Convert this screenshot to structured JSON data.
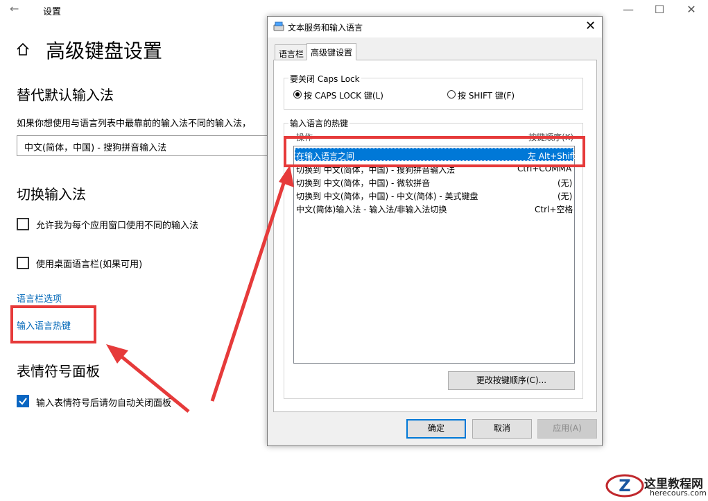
{
  "settings": {
    "title": "设置",
    "back_icon": "back-arrow-icon",
    "window_controls": [
      "—",
      "☐",
      "✕"
    ],
    "page_title": "高级键盘设置",
    "override_heading": "替代默认输入法",
    "override_desc": "如果你想使用与语言列表中最靠前的输入法不同的输入法，",
    "override_combo_value": "中文(简体，中国) - 搜狗拼音输入法",
    "switch_heading": "切换输入法",
    "checkbox_per_app": "允许我为每个应用窗口使用不同的输入法",
    "checkbox_desktop_bar": "使用桌面语言栏(如果可用)",
    "link_language_bar": "语言栏选项",
    "link_hotkeys": "输入语言热键",
    "emoji_heading": "表情符号面板",
    "checkbox_emoji": "输入表情符号后请勿自动关闭面板"
  },
  "dialog": {
    "title": "文本服务和输入语言",
    "close": "✕",
    "tabs": [
      "语言栏",
      "高级键设置"
    ],
    "capslock_group": "要关闭 Caps Lock",
    "radio_capslock": "按 CAPS LOCK 键(L)",
    "radio_shift": "按 SHIFT 键(F)",
    "hotkeys_group": "输入语言的热键",
    "col_action": "操作",
    "col_keys": "按键顺序(K)",
    "rows": [
      {
        "action": "在输入语言之间",
        "keys": "左 Alt+Shift"
      },
      {
        "action": "切换到 中文(简体，中国) - 搜狗拼音输入法",
        "keys": "Ctrl+COMMA"
      },
      {
        "action": "切换到 中文(简体，中国) - 微软拼音",
        "keys": "(无)"
      },
      {
        "action": "切换到 中文(简体，中国) - 中文(简体) - 美式键盘",
        "keys": "(无)"
      },
      {
        "action": "中文(简体)输入法 - 输入法/非输入法切换",
        "keys": "Ctrl+空格"
      }
    ],
    "change_button": "更改按键顺序(C)...",
    "ok": "确定",
    "cancel": "取消",
    "apply": "应用(A)"
  },
  "watermark": {
    "brand": "这里教程网",
    "url": "herecours.com"
  },
  "colors": {
    "accent": "#0078d7",
    "annotation_red": "#e63a3a",
    "link": "#0067b8"
  }
}
